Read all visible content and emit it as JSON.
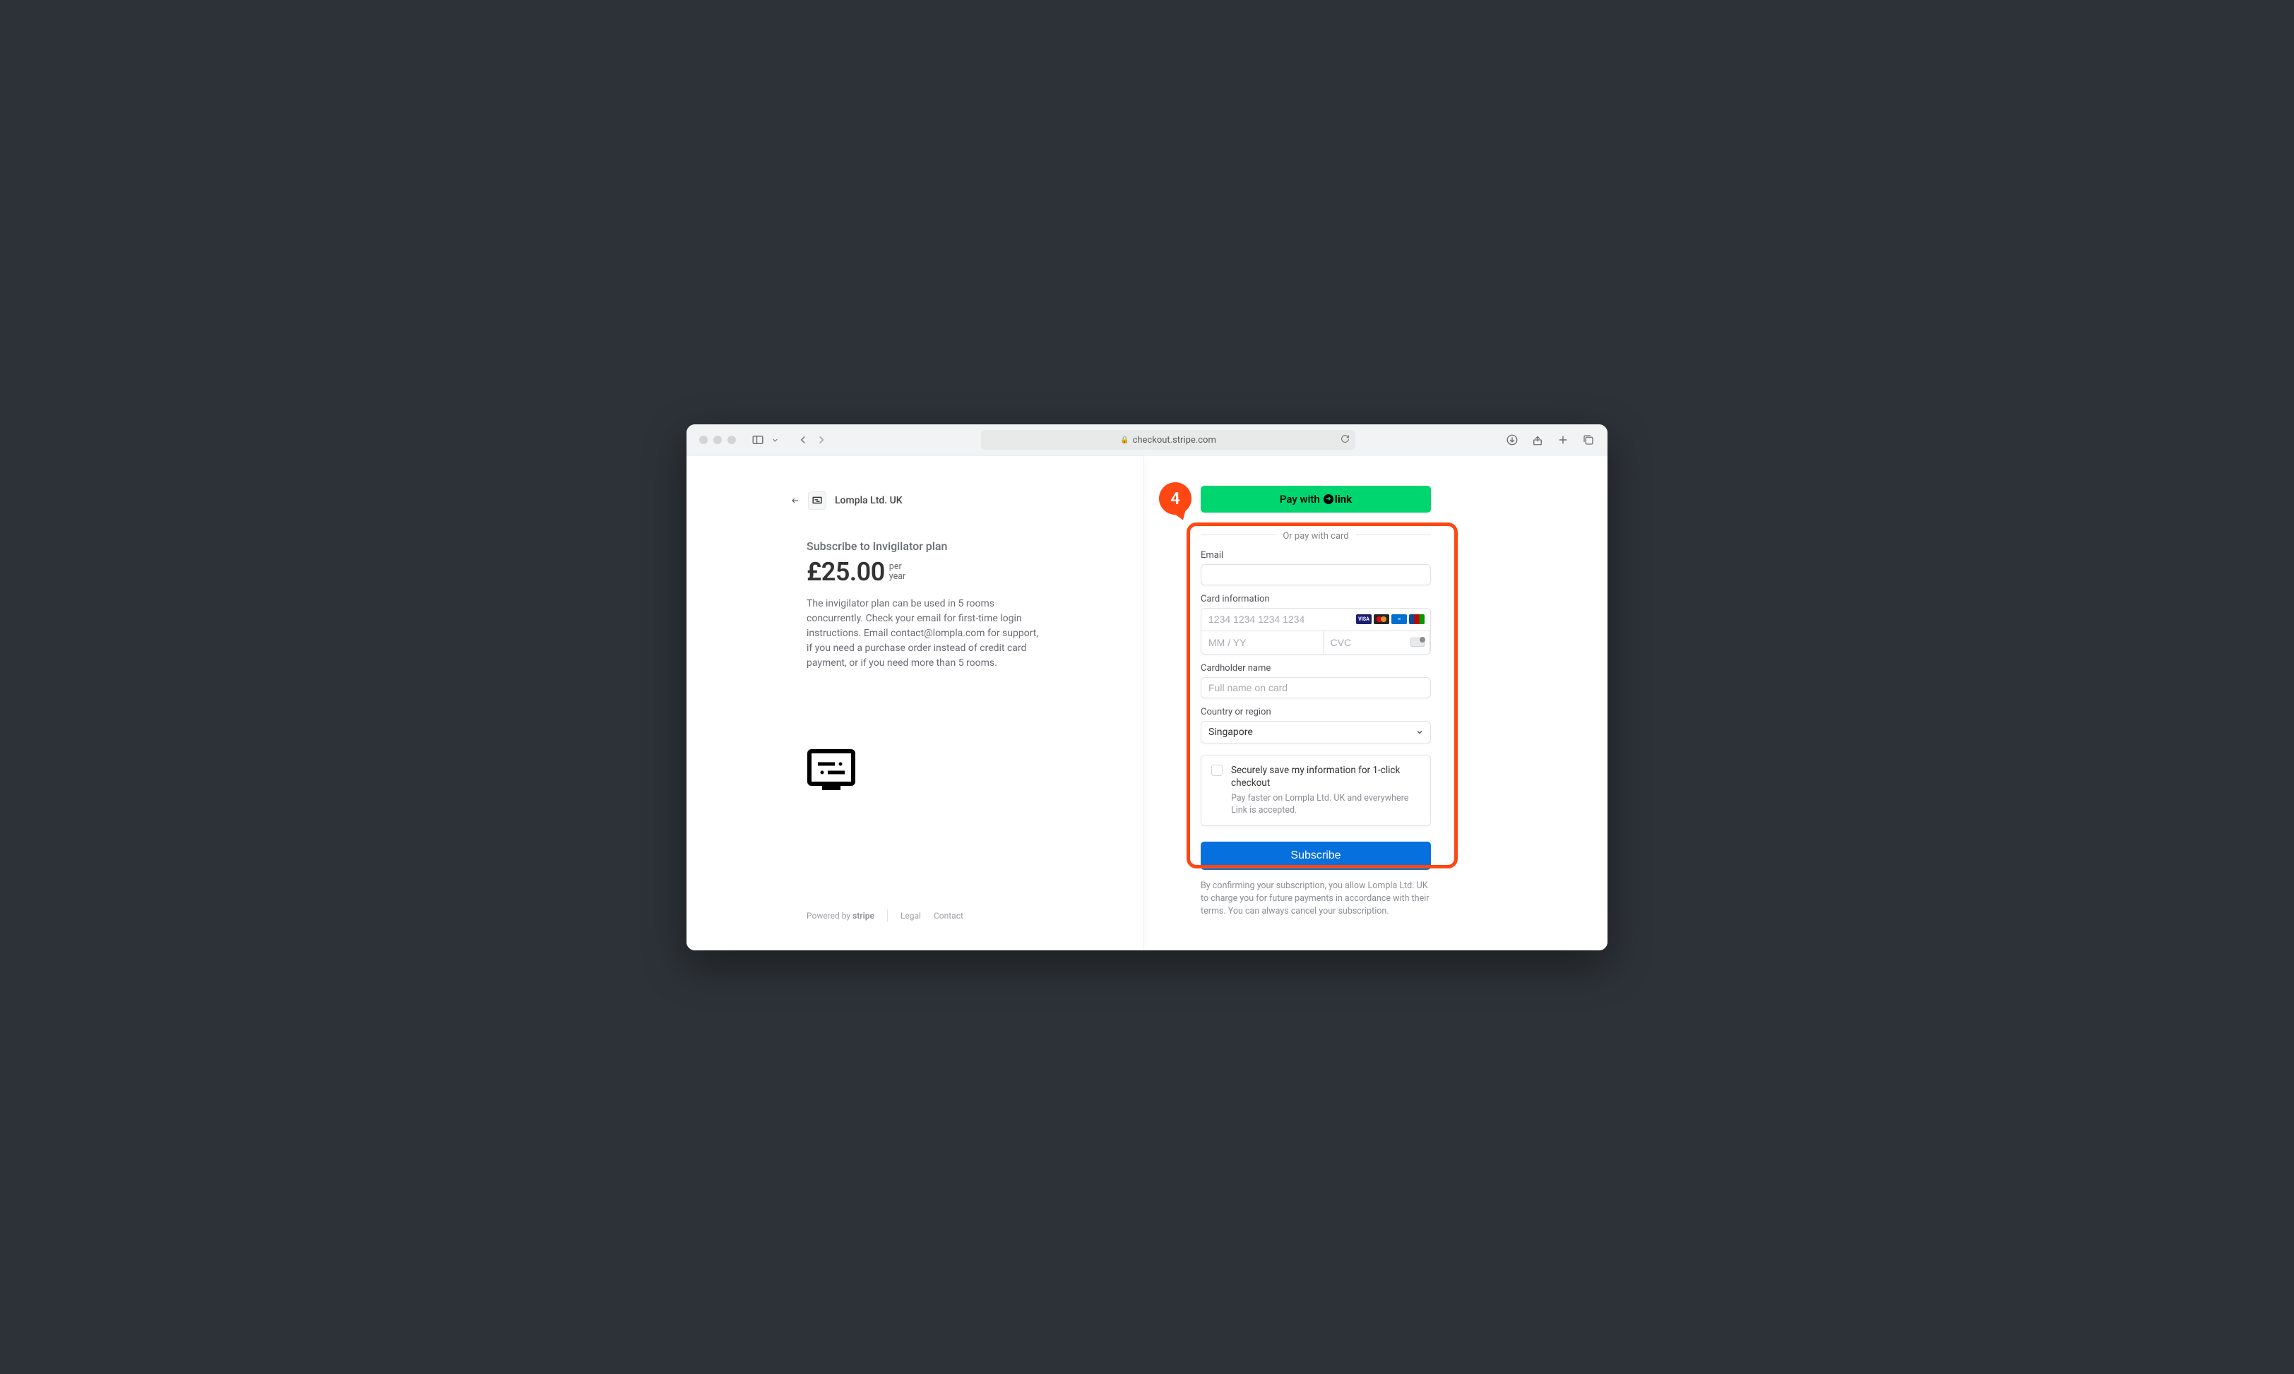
{
  "browser": {
    "url_display": "checkout.stripe.com"
  },
  "annotation": {
    "step_number": "4"
  },
  "merchant": {
    "name": "Lompla Ltd. UK"
  },
  "product": {
    "subscribe_label": "Subscribe to Invigilator plan",
    "price": "£25.00",
    "per_line1": "per",
    "per_line2": "year",
    "description": "The invigilator plan can be used in 5 rooms concurrently. Check your email for first-time login instructions. Email contact@lompla.com for support, if you need a purchase order instead of credit card payment, or if you need more than 5 rooms."
  },
  "footer": {
    "powered_by_prefix": "Powered by ",
    "powered_by_brand": "stripe",
    "legal": "Legal",
    "contact": "Contact"
  },
  "payment": {
    "link_button_prefix": "Pay with",
    "link_brand": "link",
    "divider": "Or pay with card",
    "email_label": "Email",
    "card_label": "Card information",
    "card_number_placeholder": "1234 1234 1234 1234",
    "expiry_placeholder": "MM / YY",
    "cvc_placeholder": "CVC",
    "name_label": "Cardholder name",
    "name_placeholder": "Full name on card",
    "country_label": "Country or region",
    "country_selected": "Singapore",
    "save_title": "Securely save my information for 1-click checkout",
    "save_subtitle": "Pay faster on Lompla Ltd. UK and everywhere Link is accepted.",
    "submit_label": "Subscribe",
    "disclaimer": "By confirming your subscription, you allow Lompla Ltd. UK to charge you for future payments in accordance with their terms. You can always cancel your subscription."
  }
}
